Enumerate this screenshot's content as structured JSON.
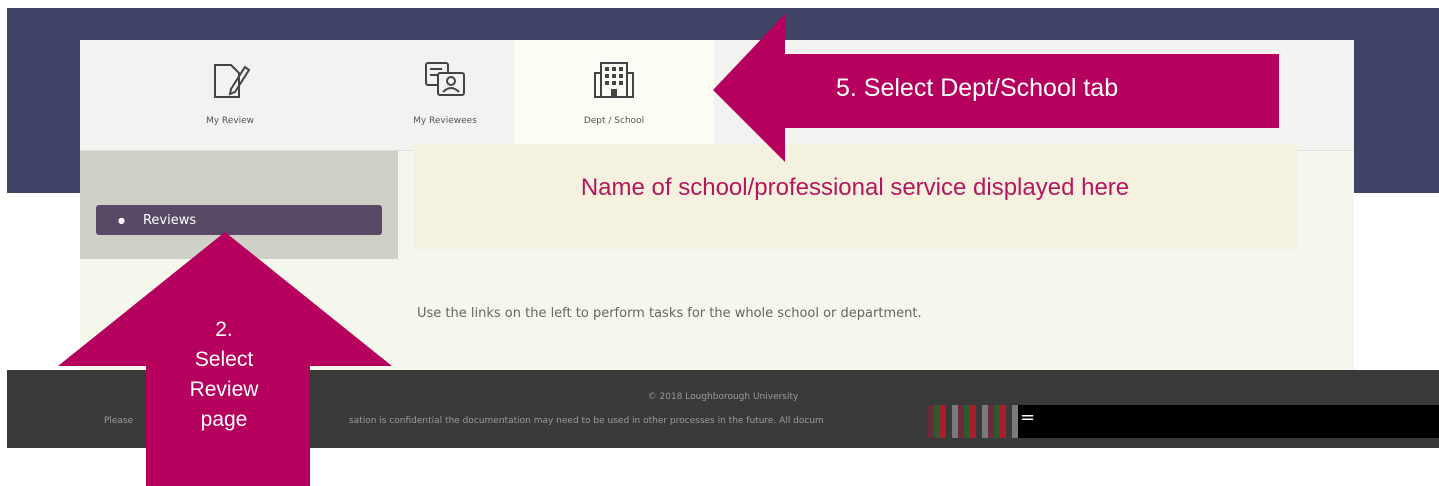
{
  "tabs": [
    {
      "label": "My Review",
      "icon": "edit-document-icon"
    },
    {
      "label": "My Reviewees",
      "icon": "reviewee-chat-icon"
    },
    {
      "label": "Dept / School",
      "icon": "building-icon"
    }
  ],
  "sidebar": {
    "items": [
      {
        "label": "Reviews"
      }
    ]
  },
  "main": {
    "banner_text": "Name of school/professional service displayed here",
    "help_text": "Use the links on the left to perform tasks for the whole school or department."
  },
  "footer": {
    "copyright": "© 2018 Loughborough University",
    "notice_left": "Please",
    "notice_right": "sation is confidential the documentation may need to be used in other processes in the future. All docum"
  },
  "annotations": {
    "tab_callout": "5.  Select Dept/School tab",
    "review_callout_line1": "2.",
    "review_callout_line2": "Select",
    "review_callout_line3": "Review",
    "review_callout_line4": "page",
    "glitch_char": "="
  },
  "colors": {
    "header_band": "#3f4466",
    "footer": "#3a3a3a",
    "accent_magenta": "#b5175e",
    "sidebar_active": "#584a66"
  }
}
